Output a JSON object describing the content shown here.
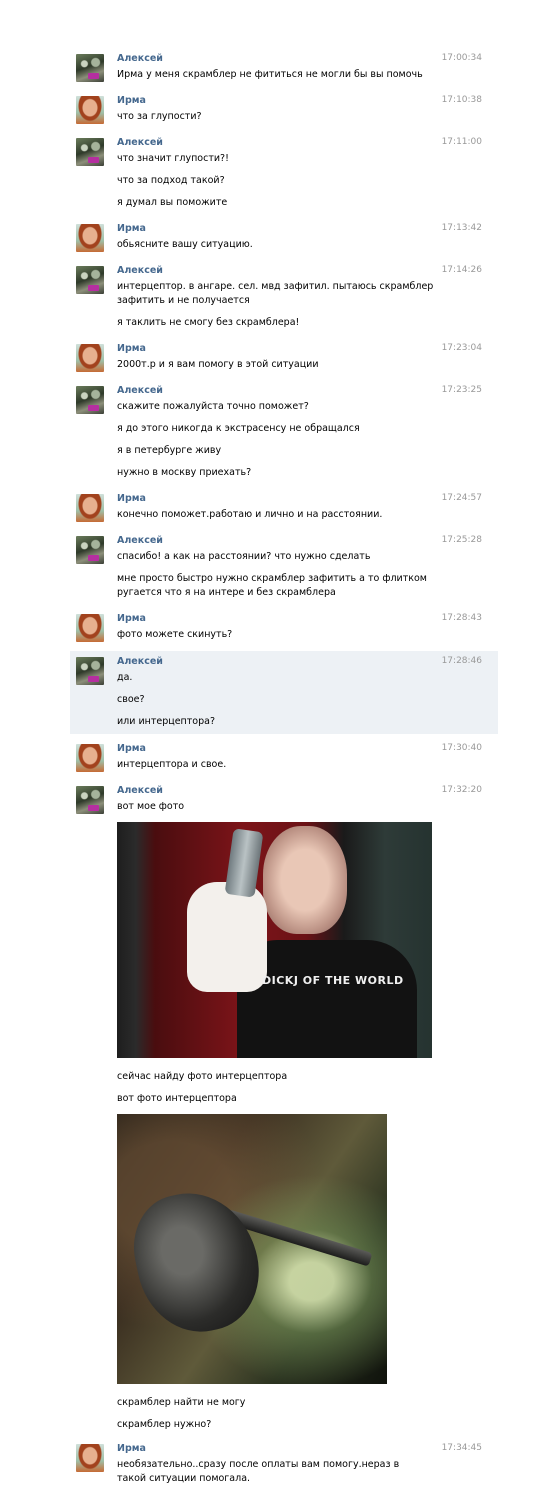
{
  "messages": [
    {
      "author": "Алексей",
      "time": "17:00:34",
      "lines": [
        "Ирма у меня скрамблер не фититься не могли бы вы помочь"
      ]
    },
    {
      "author": "Ирма",
      "time": "17:10:38",
      "lines": [
        "что за глупости?"
      ]
    },
    {
      "author": "Алексей",
      "time": "17:11:00",
      "lines": [
        "что значит глупости?!",
        "что за подход такой?",
        "я думал вы поможите"
      ]
    },
    {
      "author": "Ирма",
      "time": "17:13:42",
      "lines": [
        "обьясните вашу ситуацию."
      ]
    },
    {
      "author": "Алексей",
      "time": "17:14:26",
      "lines": [
        "интерцептор. в ангаре. сел. мвд зафитил. пытаюсь скрамблер зафитить и не получается",
        "я таклить не смогу без скрамблера!"
      ]
    },
    {
      "author": "Ирма",
      "time": "17:23:04",
      "lines": [
        "2000т.р и я вам помогу в этой ситуации"
      ]
    },
    {
      "author": "Алексей",
      "time": "17:23:25",
      "lines": [
        "скажите пожалуйста точно поможет?",
        "я до этого никогда к экстрасенсу не обращался",
        "я в петербурге живу",
        "нужно в москву приехать?"
      ]
    },
    {
      "author": "Ирма",
      "time": "17:24:57",
      "lines": [
        "конечно поможет.работаю и лично и на расстоянии."
      ]
    },
    {
      "author": "Алексей",
      "time": "17:25:28",
      "lines": [
        "спасибо! а как на расстоянии? что нужно сделать",
        "мне просто быстро нужно скрамблер зафитить а то флитком ругается что я на интере и без скрамблера"
      ]
    },
    {
      "author": "Ирма",
      "time": "17:28:43",
      "lines": [
        "фото можете скинуть?"
      ]
    },
    {
      "author": "Алексей",
      "time": "17:28:46",
      "lines": [
        "да.",
        "свое?",
        "или интерцептора?"
      ]
    },
    {
      "author": "Ирма",
      "time": "17:30:40",
      "lines": [
        "интерцептора и свое."
      ]
    },
    {
      "author": "Алексей",
      "time": "17:32:20",
      "lines": [
        "вот мое фото",
        "сейчас найду фото интерцептора",
        "вот фото интерцептора",
        "скрамблер найти не могу",
        "скрамблер нужно?"
      ],
      "photo_text": "DICKJ OF THE WORLD"
    },
    {
      "author": "Ирма",
      "time": "17:34:45",
      "lines": [
        "необязательно..сразу после оплаты вам помогу.нераз в такой ситуации помогала."
      ]
    }
  ],
  "colors": {
    "author": "#45688e",
    "time": "#999999",
    "highlight_bg": "#edf1f5"
  },
  "icons": {
    "alexey_avatar": "avatar-alexey",
    "irma_avatar": "avatar-irma"
  }
}
